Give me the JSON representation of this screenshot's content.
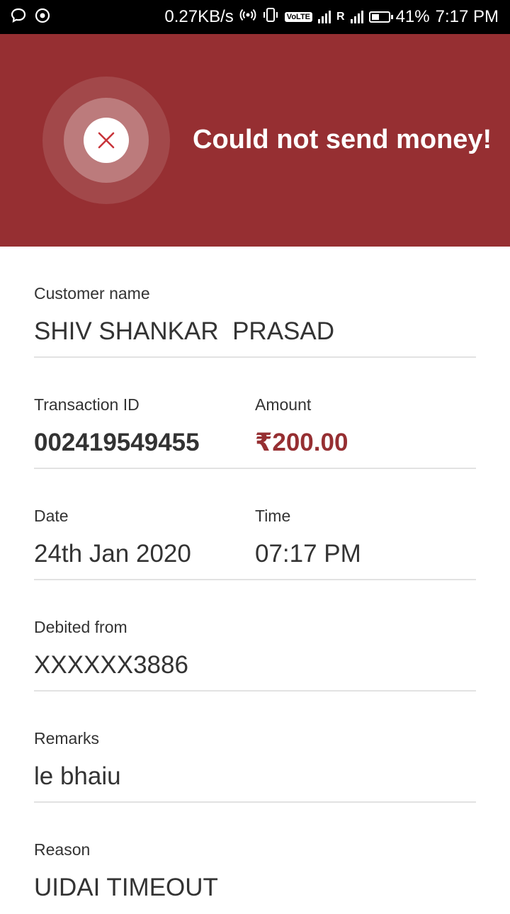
{
  "status_bar": {
    "network_speed": "0.27KB/s",
    "volte": "VoLTE",
    "lte": "LTE",
    "roaming": "R",
    "battery": "41%",
    "time": "7:17 PM"
  },
  "header": {
    "title": "Could not send money!",
    "background_color": "#962f32",
    "icon": "close-icon"
  },
  "details": {
    "customer_name": {
      "label": "Customer name",
      "value": "SHIV SHANKAR  PRASAD"
    },
    "transaction_id": {
      "label": "Transaction ID",
      "value": "002419549455"
    },
    "amount": {
      "label": "Amount",
      "value": "₹200.00",
      "color": "#962f32"
    },
    "date": {
      "label": "Date",
      "value": "24th Jan 2020"
    },
    "time": {
      "label": "Time",
      "value": "07:17 PM"
    },
    "debited_from": {
      "label": "Debited from",
      "value": "XXXXXX3886"
    },
    "remarks": {
      "label": "Remarks",
      "value": "le bhaiu"
    },
    "reason": {
      "label": "Reason",
      "value": "UIDAI TIMEOUT"
    }
  }
}
